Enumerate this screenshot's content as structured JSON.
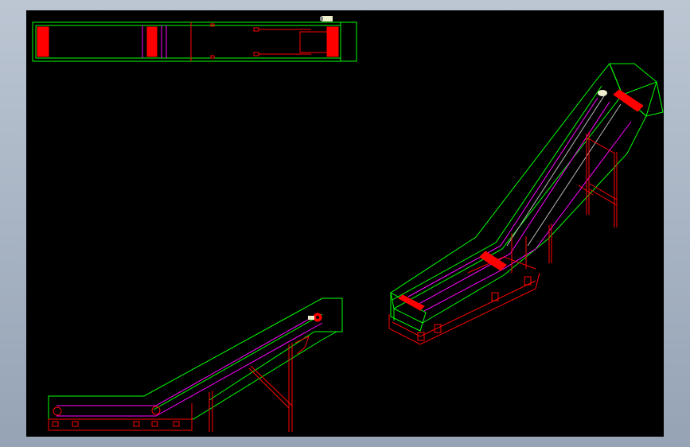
{
  "colors": {
    "frame": "#00ff00",
    "structure": "#ff0000",
    "belt": "#ff00ff",
    "shaft": "#bbbbbb",
    "background": "#000000"
  },
  "views": [
    "top-view",
    "side-view",
    "isometric-view"
  ]
}
